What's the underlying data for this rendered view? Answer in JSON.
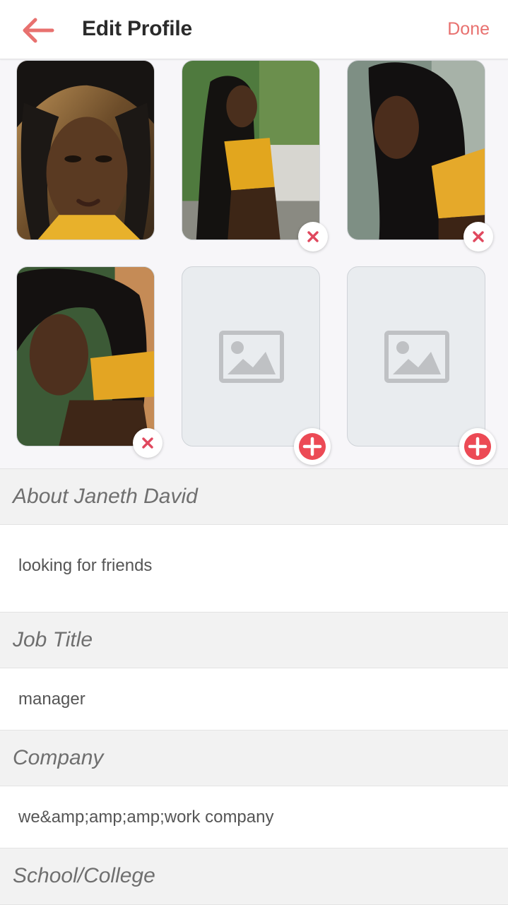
{
  "header": {
    "title": "Edit Profile",
    "done_label": "Done",
    "back_icon": "arrow-left-icon",
    "accent_color": "#e8716f"
  },
  "photos": [
    {
      "slot": 1,
      "filled": true,
      "removable": false
    },
    {
      "slot": 2,
      "filled": true,
      "removable": true,
      "remove_icon": "close-icon"
    },
    {
      "slot": 3,
      "filled": true,
      "removable": true,
      "remove_icon": "close-icon"
    },
    {
      "slot": 4,
      "filled": true,
      "removable": true,
      "remove_icon": "close-icon"
    },
    {
      "slot": 5,
      "filled": false,
      "placeholder_icon": "image-placeholder-icon",
      "add_icon": "plus-circle-icon"
    },
    {
      "slot": 6,
      "filled": false,
      "placeholder_icon": "image-placeholder-icon",
      "add_icon": "plus-circle-icon"
    }
  ],
  "about": {
    "label": "About Janeth David",
    "value": "looking for friends"
  },
  "job": {
    "label": "Job Title",
    "value": "manager"
  },
  "company": {
    "label": "Company",
    "value": "we&amp;amp;amp;work company"
  },
  "school": {
    "label": "School/College"
  }
}
